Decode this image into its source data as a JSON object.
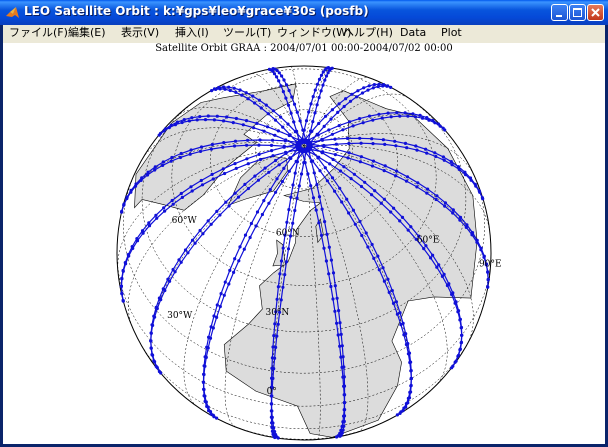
{
  "window": {
    "title": "LEO Satellite Orbit : k:¥gps¥leo¥grace¥30s (posfb)"
  },
  "menu": {
    "items": [
      "ファイル(F)",
      "編集(E)",
      "表示(V)",
      "挿入(I)",
      "ツール(T)",
      "ウィンドウ(W)",
      "ヘルプ(H)",
      "Data",
      "Plot"
    ]
  },
  "plot": {
    "title": "Satellite Orbit GRAA : 2004/07/01 00:00-2004/07/02 00:00",
    "graticule_labels": [
      "90°E",
      "60°N",
      "60°E",
      "60°W",
      "30°N",
      "30°W",
      "0°"
    ]
  },
  "colors": {
    "orbit": "#1010D8",
    "land": "#DCDCDC",
    "ocean": "#FFFFFF",
    "titlebar": "#0A52DD"
  }
}
